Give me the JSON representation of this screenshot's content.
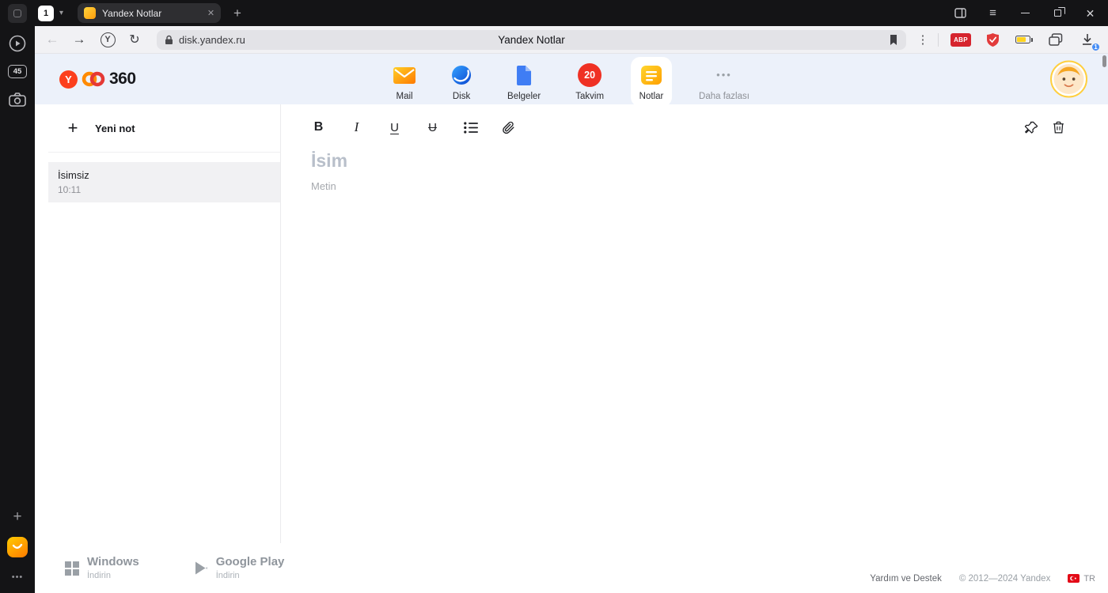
{
  "icons": {
    "back": "←",
    "forward": "→",
    "reload": "↻",
    "chevron_down": "▾",
    "close": "✕",
    "menu": "≡",
    "plus": "+",
    "dots_vertical": "⋮",
    "dots_horizontal": "•••",
    "yandex_y": "Y",
    "bold": "B",
    "italic": "I",
    "underline": "U",
    "strikethrough": "U"
  },
  "titlebar": {
    "tab_counter": "1",
    "tab_title": "Yandex Notlar"
  },
  "rail": {
    "badge": "45"
  },
  "toolbar": {
    "url": "disk.yandex.ru",
    "page_title": "Yandex Notlar",
    "abp_label": "ABP",
    "download_badge": "1"
  },
  "header": {
    "logo_y": "Y",
    "logo_text": "360",
    "apps": [
      {
        "label": "Mail"
      },
      {
        "label": "Disk"
      },
      {
        "label": "Belgeler"
      },
      {
        "label": "Takvim",
        "badge": "20"
      },
      {
        "label": "Notlar"
      },
      {
        "label": "Daha fazlası"
      }
    ]
  },
  "notes": {
    "new_note_label": "Yeni not",
    "items": [
      {
        "title": "İsimsiz",
        "time": "10:11"
      }
    ]
  },
  "editor": {
    "title_placeholder": "İsim",
    "body_placeholder": "Metin"
  },
  "footer": {
    "windows_title": "Windows",
    "windows_subtitle": "İndirin",
    "gplay_title": "Google Play",
    "gplay_subtitle": "İndirin",
    "help": "Yardım ve Destek",
    "copyright": "© 2012—2024 Yandex",
    "language": "TR"
  },
  "colors": {
    "accent_blue": "#3a79f3",
    "yandex_red": "#fc3f1d",
    "notes_yellow": "#ffb800",
    "badge_blue": "#468df5",
    "abp_red": "#d6242e"
  }
}
